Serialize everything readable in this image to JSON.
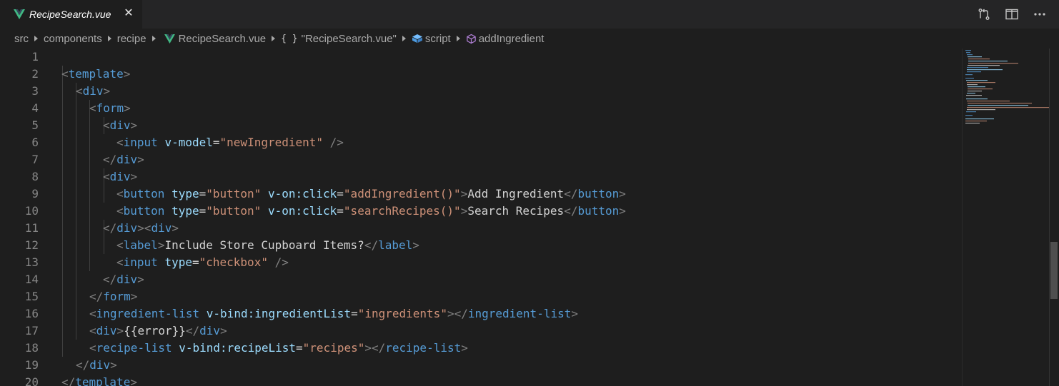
{
  "tab": {
    "label": "RecipeSearch.vue",
    "close_glyph": "✕",
    "icon": "vue-icon"
  },
  "actions": [
    {
      "name": "open-changes-icon"
    },
    {
      "name": "split-editor-icon"
    },
    {
      "name": "more-actions-icon",
      "glyph": "···"
    }
  ],
  "breadcrumb": {
    "src": "src",
    "components": "components",
    "recipe": "recipe",
    "file": "RecipeSearch.vue",
    "braces": "{ }",
    "scope": "\"RecipeSearch.vue\"",
    "script": "script",
    "method": "addIngredient"
  },
  "line_numbers": [
    "1",
    "2",
    "3",
    "4",
    "5",
    "6",
    "7",
    "8",
    "9",
    "10",
    "11",
    "12",
    "13",
    "14",
    "15",
    "16",
    "17",
    "18",
    "19",
    "20"
  ],
  "code": {
    "l1": {
      "t1": "<",
      "tag": "template",
      "t2": ">"
    },
    "l2": {
      "t1": "<",
      "tag": "div",
      "t2": ">"
    },
    "l3": {
      "t1": "<",
      "tag": "form",
      "t2": ">"
    },
    "l4": {
      "t1": "<",
      "tag": "div",
      "t2": ">"
    },
    "l5": {
      "t1": "<",
      "tag": "input",
      "attr": "v-model",
      "eq": "=",
      "val": "\"newIngredient\"",
      "t2": "/>"
    },
    "l6": {
      "t1": "</",
      "tag": "div",
      "t2": ">"
    },
    "l7": {
      "t1": "<",
      "tag": "div",
      "t2": ">"
    },
    "l8": {
      "t1": "<",
      "tag": "button",
      "a1": "type",
      "eq1": "=",
      "v1": "\"button\"",
      "a2": "v-on:click",
      "eq2": "=",
      "v2": "\"addIngredient()\"",
      "t2": ">",
      "text": "Add Ingredient",
      "t3": "</",
      "ctag": "button",
      "t4": ">"
    },
    "l9": {
      "t1": "<",
      "tag": "button",
      "a1": "type",
      "eq1": "=",
      "v1": "\"button\"",
      "a2": "v-on:click",
      "eq2": "=",
      "v2": "\"searchRecipes()\"",
      "t2": ">",
      "text": "Search Recipes",
      "t3": "</",
      "ctag": "button",
      "t4": ">"
    },
    "l10": {
      "t1": "</",
      "tag": "div",
      "t2": "><",
      "tag2": "div",
      "t3": ">"
    },
    "l11": {
      "t1": "<",
      "tag": "label",
      "t2": ">",
      "text": "Include Store Cupboard Items?",
      "t3": "</",
      "ctag": "label",
      "t4": ">"
    },
    "l12": {
      "t1": "<",
      "tag": "input",
      "attr": "type",
      "eq": "=",
      "val": "\"checkbox\"",
      "t2": "/>"
    },
    "l13": {
      "t1": "</",
      "tag": "div",
      "t2": ">"
    },
    "l14": {
      "t1": "</",
      "tag": "form",
      "t2": ">"
    },
    "l15": {
      "t1": "<",
      "tag": "ingredient-list",
      "attr": "v-bind:ingredientList",
      "eq": "=",
      "val": "\"ingredients\"",
      "t2": "></",
      "ctag": "ingredient-list",
      "t3": ">"
    },
    "l16": {
      "t1": "<",
      "tag": "div",
      "t2": ">",
      "text": "{{error}}",
      "t3": "</",
      "ctag": "div",
      "t4": ">"
    },
    "l17": {
      "t1": "<",
      "tag": "recipe-list",
      "attr": "v-bind:recipeList",
      "eq": "=",
      "val": "\"recipes\"",
      "t2": "></",
      "ctag": "recipe-list",
      "t3": ">"
    },
    "l18": {
      "t1": "</",
      "tag": "div",
      "t2": ">"
    },
    "l19": {
      "t1": "</",
      "tag": "template",
      "t2": ">"
    }
  },
  "colors": {
    "background": "#1e1e1e",
    "tag": "#569cd6",
    "attribute": "#9cdcfe",
    "string": "#ce9178",
    "punctuation": "#808080",
    "vue_green": "#41b883",
    "method_icon": "#b180d7",
    "script_icon": "#75beff"
  }
}
